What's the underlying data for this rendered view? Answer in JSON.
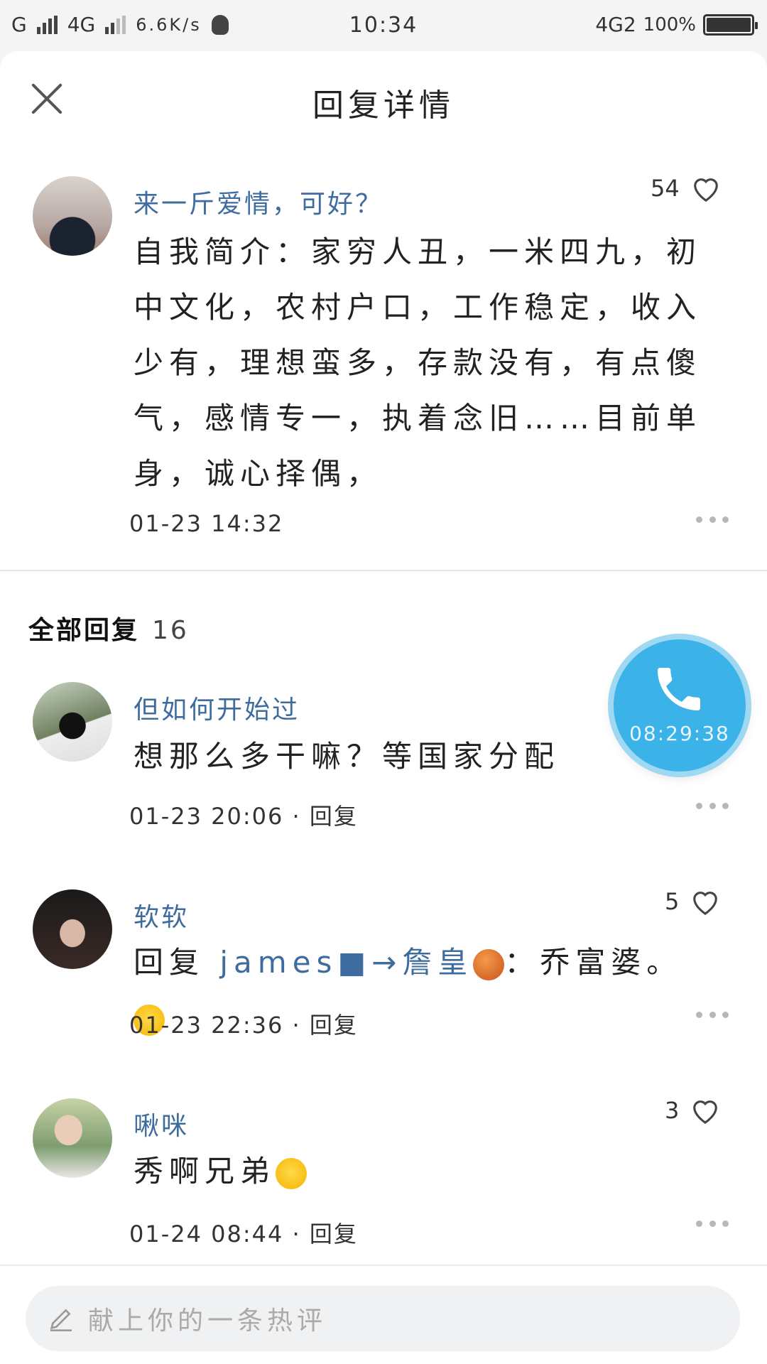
{
  "status_bar": {
    "network1": "G",
    "network2": "4G",
    "speed": "6.6K/s",
    "time": "10:34",
    "network3": "4G2",
    "battery": "100%"
  },
  "header": {
    "title": "回复详情"
  },
  "main_comment": {
    "nickname": "来一斤爱情，可好？",
    "likes": "54",
    "text": "自我简介：家穷人丑，一米四九，初中文化，农村户口，工作稳定，收入少有，理想蛮多，存款没有，有点傻气，感情专一，执着念旧……目前单身，诚心择偶，",
    "time": "01-23 14:32"
  },
  "replies_section": {
    "label": "全部回复",
    "count": "16"
  },
  "replies": [
    {
      "nickname": "但如何开始过",
      "text": "想那么多干嘛？等国家分配",
      "time": "01-23 20:06",
      "reply": "回复",
      "likes": ""
    },
    {
      "nickname": "软软",
      "prefix": "回复",
      "mention": "james■→詹皇",
      "text": "：乔富婆。",
      "time": "01-23 22:36",
      "reply": "回复",
      "likes": "5"
    },
    {
      "nickname": "啾咪",
      "text": "秀啊兄弟",
      "time": "01-24 08:44",
      "reply": "回复",
      "likes": "3"
    }
  ],
  "call_bubble": {
    "timer": "08:29:38",
    "color": "#3bb3e8"
  },
  "input": {
    "placeholder": "献上你的一条热评"
  },
  "colors": {
    "nickname": "#3e6c9f"
  }
}
